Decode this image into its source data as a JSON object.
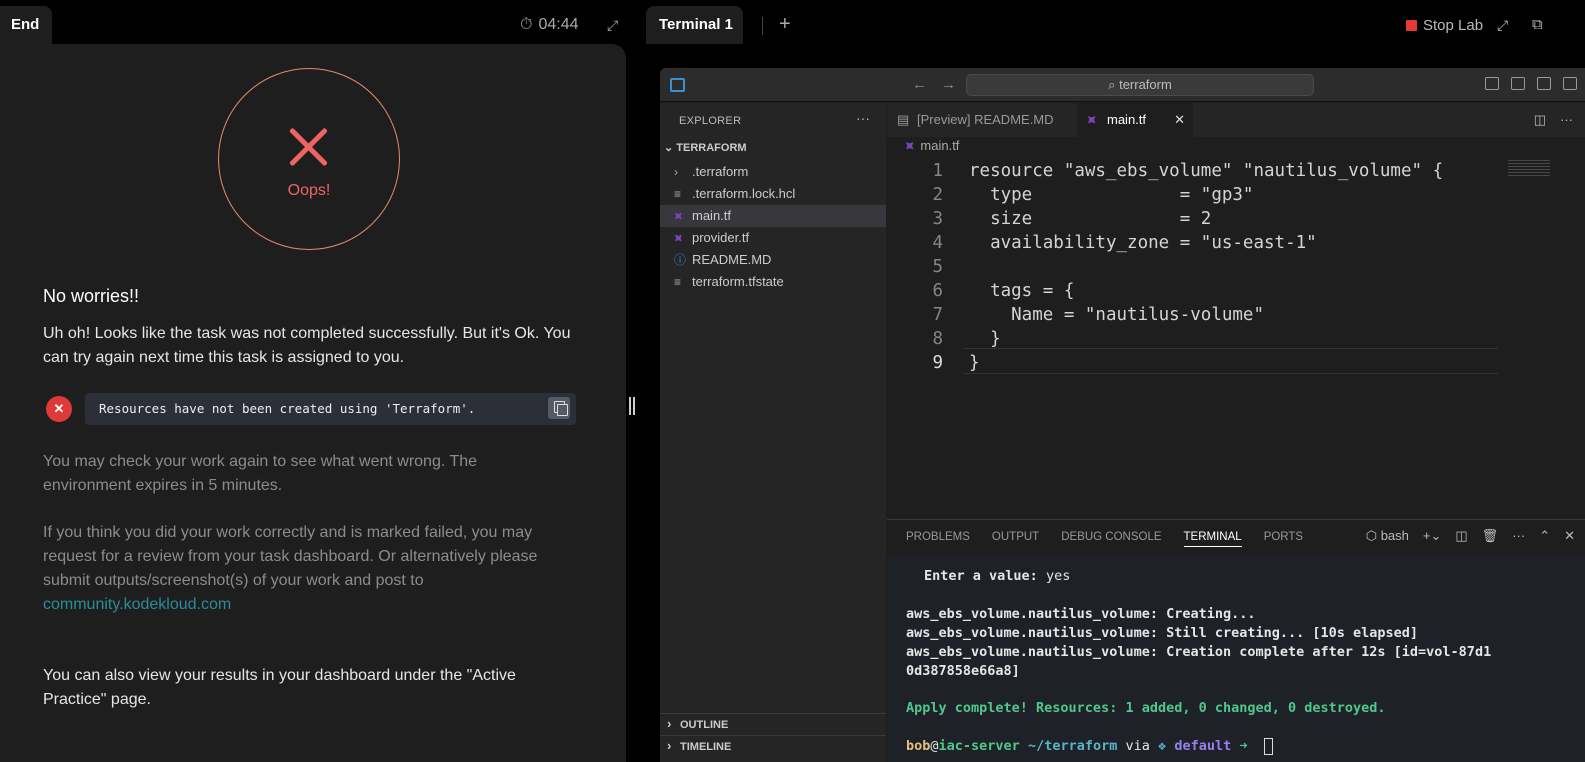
{
  "left": {
    "tab_label": "End",
    "timer": "04:44",
    "oops": "Oops!",
    "heading": "No worries!!",
    "message1": "Uh oh! Looks like the task was not completed successfully. But it's Ok. You can try again next time this task is assigned to you.",
    "error_text": "Resources have not been created using 'Terraform'.",
    "message2": "You may check your work again to see what went wrong. The environment expires in 5 minutes.",
    "message3": "If you think you did your work correctly and is marked failed, you may request for a review from your task dashboard. Or alternatively please submit outputs/screenshot(s) of your work and post to",
    "link": "community.kodekloud.com",
    "message4": "You can also view your results in your dashboard under the \"Active Practice\" page."
  },
  "right": {
    "tab_label": "Terminal 1",
    "stop_lab": "Stop Lab"
  },
  "vscode": {
    "search": "terraform",
    "explorer_title": "EXPLORER",
    "folder": "TERRAFORM",
    "files": [
      ".terraform",
      ".terraform.lock.hcl",
      "main.tf",
      "provider.tf",
      "README.MD",
      "terraform.tfstate"
    ],
    "sections": [
      "OUTLINE",
      "TIMELINE"
    ],
    "tabs": [
      "[Preview] README.MD",
      "main.tf"
    ],
    "breadcrumb": "main.tf",
    "code": [
      "resource \"aws_ebs_volume\" \"nautilus_volume\" {",
      "  type              = \"gp3\"",
      "  size              = 2",
      "  availability_zone = \"us-east-1\"",
      "",
      "  tags = {",
      "    Name = \"nautilus-volume\"",
      "  }",
      "}"
    ],
    "panel_tabs": [
      "PROBLEMS",
      "OUTPUT",
      "DEBUG CONSOLE",
      "TERMINAL",
      "PORTS"
    ],
    "shell": "bash",
    "terminal": {
      "prompt_label": "Enter a value:",
      "prompt_value": "yes",
      "lines": [
        "aws_ebs_volume.nautilus_volume: Creating...",
        "aws_ebs_volume.nautilus_volume: Still creating... [10s elapsed]",
        "aws_ebs_volume.nautilus_volume: Creation complete after 12s [id=vol-87d1",
        "0d387858e66a8]"
      ],
      "apply": "Apply complete! Resources: 1 added, 0 changed, 0 destroyed.",
      "ps_user": "bob",
      "ps_at": "@",
      "ps_host": "iac-server",
      "ps_path": "~/terraform",
      "ps_via": "via",
      "ps_ctx": "default",
      "ps_arrow": "➜"
    }
  }
}
